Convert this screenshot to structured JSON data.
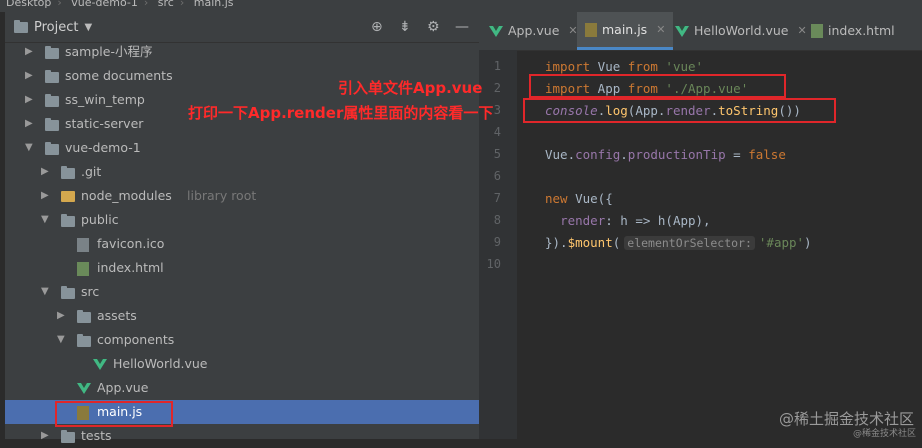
{
  "breadcrumb": {
    "items": [
      "Desktop",
      "vue-demo-1",
      "src",
      "main.js"
    ]
  },
  "project_panel": {
    "title": "Project",
    "tree": [
      {
        "label": "sample-小程序",
        "type": "folder",
        "depth": 1,
        "expanded": false
      },
      {
        "label": "some documents",
        "type": "folder",
        "depth": 1,
        "expanded": false
      },
      {
        "label": "ss_win_temp",
        "type": "folder",
        "depth": 1,
        "expanded": false
      },
      {
        "label": "static-server",
        "type": "folder",
        "depth": 1,
        "expanded": false
      },
      {
        "label": "vue-demo-1",
        "type": "folder",
        "depth": 1,
        "expanded": true
      },
      {
        "label": ".git",
        "type": "folder",
        "depth": 2,
        "expanded": false
      },
      {
        "label": "node_modules",
        "hint": "library root",
        "type": "ext-folder",
        "depth": 2,
        "expanded": false
      },
      {
        "label": "public",
        "type": "folder",
        "depth": 2,
        "expanded": true
      },
      {
        "label": "favicon.ico",
        "type": "file",
        "depth": 3
      },
      {
        "label": "index.html",
        "type": "html",
        "depth": 3
      },
      {
        "label": "src",
        "type": "folder",
        "depth": 2,
        "expanded": true
      },
      {
        "label": "assets",
        "type": "folder",
        "depth": 3,
        "expanded": false
      },
      {
        "label": "components",
        "type": "folder",
        "depth": 3,
        "expanded": true
      },
      {
        "label": "HelloWorld.vue",
        "type": "vue",
        "depth": 4
      },
      {
        "label": "App.vue",
        "type": "vue",
        "depth": 3
      },
      {
        "label": "main.js",
        "type": "js",
        "depth": 3,
        "selected": true
      },
      {
        "label": "tests",
        "type": "folder",
        "depth": 2,
        "expanded": false
      }
    ]
  },
  "editor": {
    "tabs": [
      {
        "label": "App.vue",
        "icon": "vue-icon",
        "active": false,
        "closable": true
      },
      {
        "label": "main.js",
        "icon": "js-file-icon",
        "active": true,
        "closable": true
      },
      {
        "label": "HelloWorld.vue",
        "icon": "vue-icon",
        "active": false,
        "closable": true
      },
      {
        "label": "index.html",
        "icon": "html-file-icon",
        "active": false,
        "closable": false
      }
    ],
    "line_numbers": [
      "1",
      "2",
      "3",
      "4",
      "5",
      "6",
      "7",
      "8",
      "9",
      "10"
    ],
    "code": {
      "l1": {
        "kw1": "import",
        "name": " Vue ",
        "kw2": "from",
        "str": " 'vue'"
      },
      "l2": {
        "kw1": "import",
        "name": " App ",
        "kw2": "from",
        "str": " './App.vue'"
      },
      "l3": {
        "obj": "console",
        "dot1": ".",
        "m1": "log",
        "p1": "(App.",
        "prop": "render",
        "dot2": ".",
        "m2": "toString",
        "p2": "())"
      },
      "l5": {
        "pre": "Vue.",
        "p1": "config",
        "dot": ".",
        "p2": "productionTip",
        "eq": " = ",
        "val": "false"
      },
      "l7": {
        "kw": "new",
        "rest": " Vue({"
      },
      "l8": {
        "indent": "  ",
        "prop": "render",
        "rest": ": h => h(App),"
      },
      "l9": {
        "pre": "}).",
        "fn": "$mount",
        "paren": "(",
        "hint": "elementOrSelector:",
        "str": "'#app'",
        "close": ")"
      }
    }
  },
  "annotations": {
    "a1": "引入单文件App.vue",
    "a2": "打印一下App.render属性里面的内容看一下"
  },
  "watermark": {
    "main": "@稀土掘金技术社区",
    "small": "@稀金技术社区"
  },
  "colors": {
    "selection": "#4b6eaf",
    "annotation": "#e0262a",
    "panel": "#3c3f41",
    "editor": "#2b2b2b"
  }
}
